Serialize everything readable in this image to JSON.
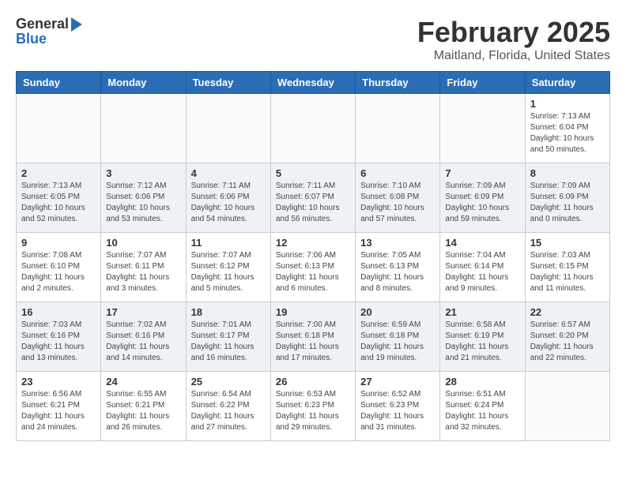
{
  "header": {
    "logo_general": "General",
    "logo_blue": "Blue",
    "month": "February 2025",
    "location": "Maitland, Florida, United States"
  },
  "weekdays": [
    "Sunday",
    "Monday",
    "Tuesday",
    "Wednesday",
    "Thursday",
    "Friday",
    "Saturday"
  ],
  "weeks": [
    [
      {
        "day": "",
        "info": ""
      },
      {
        "day": "",
        "info": ""
      },
      {
        "day": "",
        "info": ""
      },
      {
        "day": "",
        "info": ""
      },
      {
        "day": "",
        "info": ""
      },
      {
        "day": "",
        "info": ""
      },
      {
        "day": "1",
        "info": "Sunrise: 7:13 AM\nSunset: 6:04 PM\nDaylight: 10 hours\nand 50 minutes."
      }
    ],
    [
      {
        "day": "2",
        "info": "Sunrise: 7:13 AM\nSunset: 6:05 PM\nDaylight: 10 hours\nand 52 minutes."
      },
      {
        "day": "3",
        "info": "Sunrise: 7:12 AM\nSunset: 6:06 PM\nDaylight: 10 hours\nand 53 minutes."
      },
      {
        "day": "4",
        "info": "Sunrise: 7:11 AM\nSunset: 6:06 PM\nDaylight: 10 hours\nand 54 minutes."
      },
      {
        "day": "5",
        "info": "Sunrise: 7:11 AM\nSunset: 6:07 PM\nDaylight: 10 hours\nand 56 minutes."
      },
      {
        "day": "6",
        "info": "Sunrise: 7:10 AM\nSunset: 6:08 PM\nDaylight: 10 hours\nand 57 minutes."
      },
      {
        "day": "7",
        "info": "Sunrise: 7:09 AM\nSunset: 6:09 PM\nDaylight: 10 hours\nand 59 minutes."
      },
      {
        "day": "8",
        "info": "Sunrise: 7:09 AM\nSunset: 6:09 PM\nDaylight: 11 hours\nand 0 minutes."
      }
    ],
    [
      {
        "day": "9",
        "info": "Sunrise: 7:08 AM\nSunset: 6:10 PM\nDaylight: 11 hours\nand 2 minutes."
      },
      {
        "day": "10",
        "info": "Sunrise: 7:07 AM\nSunset: 6:11 PM\nDaylight: 11 hours\nand 3 minutes."
      },
      {
        "day": "11",
        "info": "Sunrise: 7:07 AM\nSunset: 6:12 PM\nDaylight: 11 hours\nand 5 minutes."
      },
      {
        "day": "12",
        "info": "Sunrise: 7:06 AM\nSunset: 6:13 PM\nDaylight: 11 hours\nand 6 minutes."
      },
      {
        "day": "13",
        "info": "Sunrise: 7:05 AM\nSunset: 6:13 PM\nDaylight: 11 hours\nand 8 minutes."
      },
      {
        "day": "14",
        "info": "Sunrise: 7:04 AM\nSunset: 6:14 PM\nDaylight: 11 hours\nand 9 minutes."
      },
      {
        "day": "15",
        "info": "Sunrise: 7:03 AM\nSunset: 6:15 PM\nDaylight: 11 hours\nand 11 minutes."
      }
    ],
    [
      {
        "day": "16",
        "info": "Sunrise: 7:03 AM\nSunset: 6:16 PM\nDaylight: 11 hours\nand 13 minutes."
      },
      {
        "day": "17",
        "info": "Sunrise: 7:02 AM\nSunset: 6:16 PM\nDaylight: 11 hours\nand 14 minutes."
      },
      {
        "day": "18",
        "info": "Sunrise: 7:01 AM\nSunset: 6:17 PM\nDaylight: 11 hours\nand 16 minutes."
      },
      {
        "day": "19",
        "info": "Sunrise: 7:00 AM\nSunset: 6:18 PM\nDaylight: 11 hours\nand 17 minutes."
      },
      {
        "day": "20",
        "info": "Sunrise: 6:59 AM\nSunset: 6:18 PM\nDaylight: 11 hours\nand 19 minutes."
      },
      {
        "day": "21",
        "info": "Sunrise: 6:58 AM\nSunset: 6:19 PM\nDaylight: 11 hours\nand 21 minutes."
      },
      {
        "day": "22",
        "info": "Sunrise: 6:57 AM\nSunset: 6:20 PM\nDaylight: 11 hours\nand 22 minutes."
      }
    ],
    [
      {
        "day": "23",
        "info": "Sunrise: 6:56 AM\nSunset: 6:21 PM\nDaylight: 11 hours\nand 24 minutes."
      },
      {
        "day": "24",
        "info": "Sunrise: 6:55 AM\nSunset: 6:21 PM\nDaylight: 11 hours\nand 26 minutes."
      },
      {
        "day": "25",
        "info": "Sunrise: 6:54 AM\nSunset: 6:22 PM\nDaylight: 11 hours\nand 27 minutes."
      },
      {
        "day": "26",
        "info": "Sunrise: 6:53 AM\nSunset: 6:23 PM\nDaylight: 11 hours\nand 29 minutes."
      },
      {
        "day": "27",
        "info": "Sunrise: 6:52 AM\nSunset: 6:23 PM\nDaylight: 11 hours\nand 31 minutes."
      },
      {
        "day": "28",
        "info": "Sunrise: 6:51 AM\nSunset: 6:24 PM\nDaylight: 11 hours\nand 32 minutes."
      },
      {
        "day": "",
        "info": ""
      }
    ]
  ]
}
